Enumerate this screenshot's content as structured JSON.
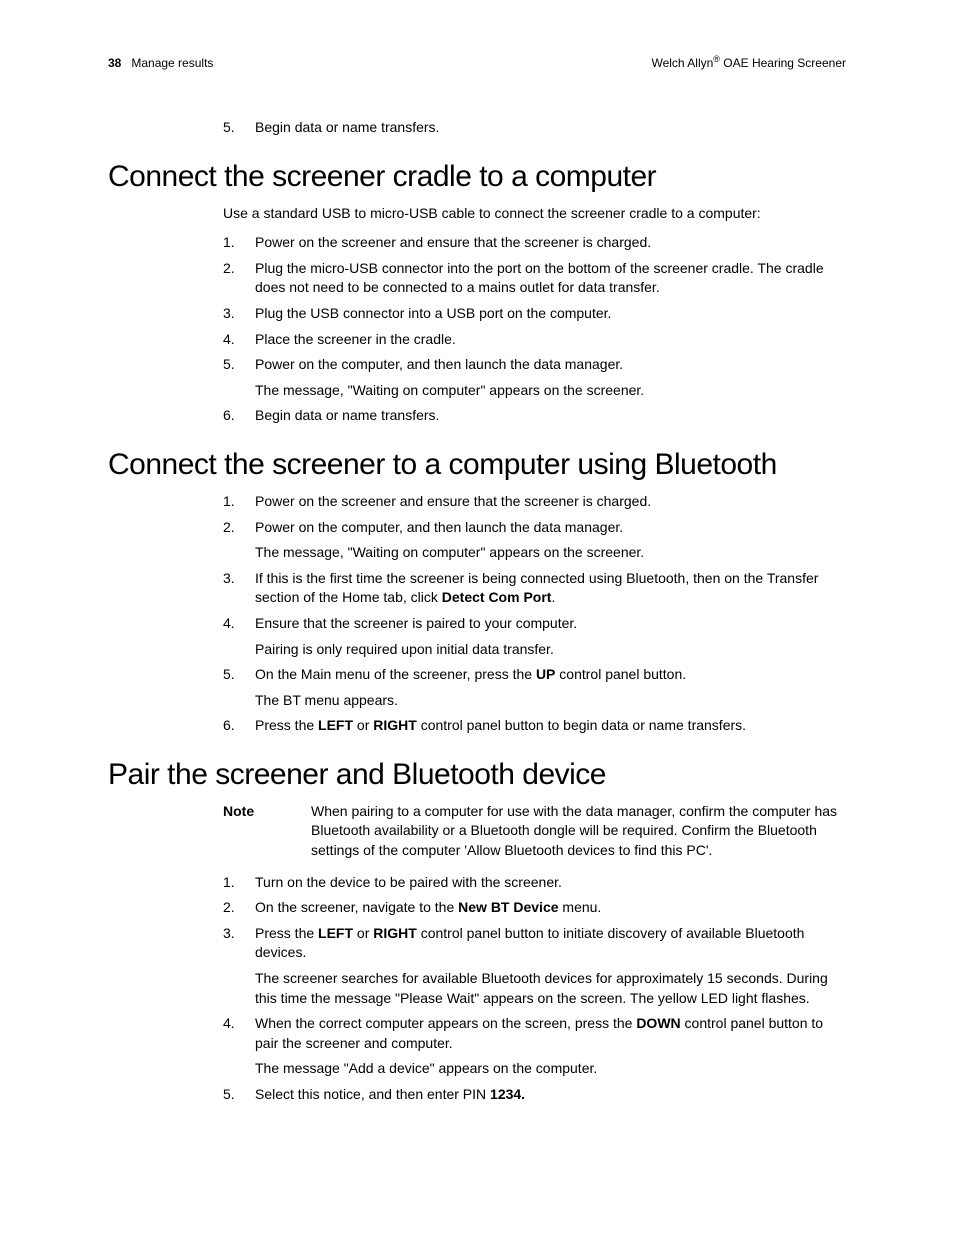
{
  "header": {
    "page_number": "38",
    "left_title": "Manage results",
    "right_brand_prefix": "Welch Allyn",
    "right_reg": "®",
    "right_brand_suffix": " OAE Hearing Screener"
  },
  "top_list": [
    {
      "n": "5.",
      "t": "Begin data or name transfers."
    }
  ],
  "section1": {
    "heading": "Connect the screener cradle to a computer",
    "intro": "Use a standard USB to micro-USB cable to connect the screener cradle to a computer:",
    "items": [
      {
        "n": "1.",
        "t": "Power on the screener and ensure that the screener is charged."
      },
      {
        "n": "2.",
        "t": "Plug the micro-USB connector into the port on the bottom of the screener cradle. The cradle does not need to be connected to a mains outlet for data transfer."
      },
      {
        "n": "3.",
        "t": "Plug the USB connector into a USB port on the computer."
      },
      {
        "n": "4.",
        "t": "Place the screener in the cradle."
      },
      {
        "n": "5.",
        "t": "Power on the computer, and then launch the data manager.",
        "sub": "The message, \"Waiting on computer\" appears on the screener."
      },
      {
        "n": "6.",
        "t": "Begin data or name transfers."
      }
    ]
  },
  "section2": {
    "heading": "Connect the screener to a computer using Bluetooth",
    "items": [
      {
        "n": "1.",
        "t": "Power on the screener and ensure that the screener is charged."
      },
      {
        "n": "2.",
        "t": "Power on the computer, and then launch the data manager.",
        "sub": "The message, \"Waiting on computer\" appears on the screener."
      },
      {
        "n": "3.",
        "pre": "If this is the first time the screener is being connected using Bluetooth, then on the Transfer section of the Home tab, click ",
        "bold": "Detect Com Port",
        "post": "."
      },
      {
        "n": "4.",
        "t": "Ensure that the screener is paired to your computer.",
        "sub": "Pairing is only required upon initial data transfer."
      },
      {
        "n": "5.",
        "pre": "On the Main menu of the screener, press the ",
        "bold": "UP",
        "post": " control panel button.",
        "sub": "The BT menu appears."
      },
      {
        "n": "6.",
        "pre": "Press the ",
        "bold": "LEFT",
        "mid": " or ",
        "bold2": "RIGHT",
        "post": " control panel button to begin data or name transfers."
      }
    ]
  },
  "section3": {
    "heading": "Pair the screener and Bluetooth device",
    "note_label": "Note",
    "note_text": "When pairing to a computer for use with the data manager, confirm the computer has Bluetooth availability or a Bluetooth dongle will be required. Confirm the Bluetooth settings of the computer 'Allow Bluetooth devices to find this PC'.",
    "items": [
      {
        "n": "1.",
        "t": "Turn on the device to be paired with the screener."
      },
      {
        "n": "2.",
        "pre": "On the screener, navigate to the ",
        "bold": "New BT Device",
        "post": " menu."
      },
      {
        "n": "3.",
        "pre": "Press the ",
        "bold": "LEFT",
        "mid": " or ",
        "bold2": "RIGHT",
        "post": " control panel button to initiate discovery of available Bluetooth devices.",
        "sub": "The screener searches for available Bluetooth devices for approximately 15 seconds. During this time the message \"Please Wait\" appears on the screen. The yellow LED light flashes."
      },
      {
        "n": "4.",
        "pre": "When the correct computer appears on the screen, press the ",
        "bold": "DOWN",
        "post": " control panel button to pair the screener and computer.",
        "sub": "The message \"Add a device\" appears on the computer."
      },
      {
        "n": "5.",
        "pre": "Select this notice, and then enter PIN ",
        "bold": "1234.",
        "post": ""
      }
    ]
  }
}
